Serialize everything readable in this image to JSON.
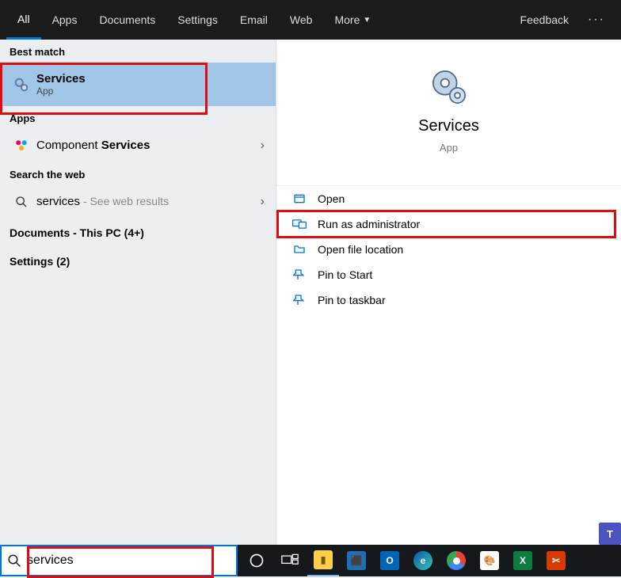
{
  "tabs": {
    "all": "All",
    "apps": "Apps",
    "documents": "Documents",
    "settings": "Settings",
    "email": "Email",
    "web": "Web",
    "more": "More"
  },
  "feedback": "Feedback",
  "sections": {
    "best_match": "Best match",
    "apps": "Apps",
    "search_web": "Search the web"
  },
  "best": {
    "title": "Services",
    "sub": "App"
  },
  "apps_result": {
    "prefix": "Component ",
    "bold": "Services"
  },
  "web_result": {
    "query": "services",
    "suffix": " - See web results"
  },
  "docs_line": "Documents - This PC (4+)",
  "settings_line": "Settings (2)",
  "preview": {
    "name": "Services",
    "type": "App"
  },
  "actions": {
    "open": "Open",
    "run_admin": "Run as administrator",
    "open_location": "Open file location",
    "pin_start": "Pin to Start",
    "pin_taskbar": "Pin to taskbar"
  },
  "search_value": "services"
}
